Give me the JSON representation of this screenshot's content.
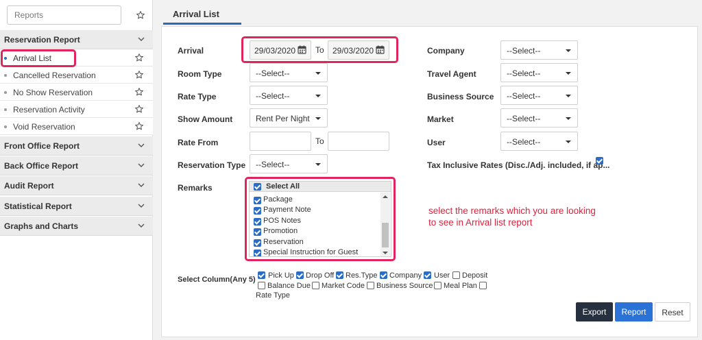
{
  "sidebar": {
    "search_placeholder": "Reports",
    "sections": [
      {
        "label": "Reservation Report",
        "expanded": true,
        "items": [
          {
            "label": "Arrival List",
            "active": true
          },
          {
            "label": "Cancelled Reservation",
            "active": false
          },
          {
            "label": "No Show Reservation",
            "active": false
          },
          {
            "label": "Reservation Activity",
            "active": false
          },
          {
            "label": "Void Reservation",
            "active": false
          }
        ]
      },
      {
        "label": "Front Office Report",
        "expanded": false
      },
      {
        "label": "Back Office Report",
        "expanded": false
      },
      {
        "label": "Audit Report",
        "expanded": false
      },
      {
        "label": "Statistical Report",
        "expanded": false
      },
      {
        "label": "Graphs and Charts",
        "expanded": false
      }
    ]
  },
  "tab": {
    "label": "Arrival List"
  },
  "form": {
    "arrival": {
      "label": "Arrival",
      "from": "29/03/2020",
      "to_label": "To",
      "to": "29/03/2020"
    },
    "room_type": {
      "label": "Room Type",
      "value": "--Select--"
    },
    "rate_type": {
      "label": "Rate Type",
      "value": "--Select--"
    },
    "show_amount": {
      "label": "Show Amount",
      "value": "Rent Per Night"
    },
    "rate_from": {
      "label": "Rate From",
      "to_label": "To",
      "from_value": "",
      "to_value": ""
    },
    "reservation_type": {
      "label": "Reservation Type",
      "value": "--Select--"
    },
    "company": {
      "label": "Company",
      "value": "--Select--"
    },
    "travel_agent": {
      "label": "Travel Agent",
      "value": "--Select--"
    },
    "business_source": {
      "label": "Business Source",
      "value": "--Select--"
    },
    "market": {
      "label": "Market",
      "value": "--Select--"
    },
    "user": {
      "label": "User",
      "value": "--Select--"
    },
    "tax_inclusive": {
      "label": "Tax Inclusive Rates (Disc./Adj. included, if ap...",
      "checked": true
    },
    "remarks": {
      "label": "Remarks",
      "select_all_label": "Select All",
      "items": [
        {
          "label": "Package",
          "checked": true
        },
        {
          "label": "Payment Note",
          "checked": true
        },
        {
          "label": "POS Notes",
          "checked": true
        },
        {
          "label": "Promotion",
          "checked": true
        },
        {
          "label": "Reservation",
          "checked": true
        },
        {
          "label": "Special Instruction for Guest",
          "checked": true
        }
      ]
    },
    "select_column": {
      "label": "Select Column(Any 5)",
      "options": [
        {
          "label": "Pick Up",
          "checked": true
        },
        {
          "label": "Drop Off",
          "checked": true
        },
        {
          "label": "Res.Type",
          "checked": true
        },
        {
          "label": "Company",
          "checked": true
        },
        {
          "label": "User",
          "checked": true
        },
        {
          "label": "Deposit",
          "checked": false
        },
        {
          "label": "Balance Due",
          "checked": false
        },
        {
          "label": "Market Code",
          "checked": false
        },
        {
          "label": "Business Source",
          "checked": false
        },
        {
          "label": "Meal Plan",
          "checked": false
        },
        {
          "label": "Rate Type",
          "checked": false
        }
      ]
    }
  },
  "annotation": {
    "text": "select the remarks which you are looking to see in Arrival list report"
  },
  "buttons": {
    "export": "Export",
    "report": "Report",
    "reset": "Reset"
  },
  "colors": {
    "accent": "#2a72d6",
    "highlight": "#e0245e",
    "annotation": "#e0213c",
    "export_bg": "#26303f"
  }
}
